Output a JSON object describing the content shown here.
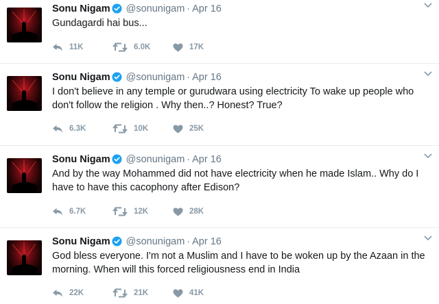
{
  "colors": {
    "icon": "#8899a6",
    "verified": "#1da1f2",
    "name": "#14171a",
    "meta": "#657786"
  },
  "tweets": [
    {
      "author": "Sonu Nigam",
      "handle": "@sonunigam",
      "separator": "·",
      "date": "Apr 16",
      "text": "Gundagardi hai bus...",
      "replies": "11K",
      "retweets": "6.0K",
      "likes": "17K"
    },
    {
      "author": "Sonu Nigam",
      "handle": "@sonunigam",
      "separator": "·",
      "date": "Apr 16",
      "text": "I don't believe in any temple or gurudwara using electricity To wake up people who don't follow the religion . Why then..? Honest? True?",
      "replies": "6.3K",
      "retweets": "10K",
      "likes": "25K"
    },
    {
      "author": "Sonu Nigam",
      "handle": "@sonunigam",
      "separator": "·",
      "date": "Apr 16",
      "text": "And by the way Mohammed did not have electricity when he made Islam.. Why do I have to have this cacophony after Edison?",
      "replies": "6.7K",
      "retweets": "12K",
      "likes": "28K"
    },
    {
      "author": "Sonu Nigam",
      "handle": "@sonunigam",
      "separator": "·",
      "date": "Apr 16",
      "text": "God bless everyone. I'm not a Muslim and I have to be woken up by the Azaan in the morning. When will this forced religiousness end in India",
      "replies": "22K",
      "retweets": "21K",
      "likes": "41K"
    }
  ]
}
